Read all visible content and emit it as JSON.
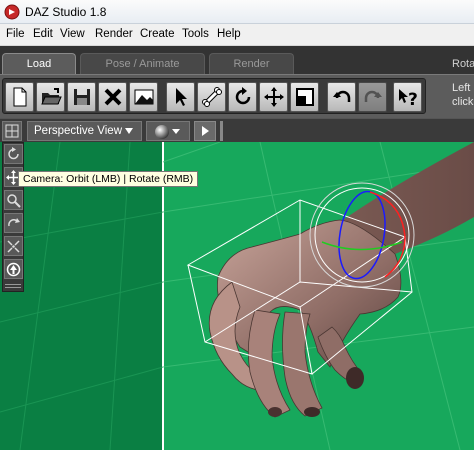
{
  "window": {
    "title": "DAZ Studio 1.8"
  },
  "menu": [
    {
      "label": "File"
    },
    {
      "label": "Edit"
    },
    {
      "label": "View"
    },
    {
      "label": "Render"
    },
    {
      "label": "Create"
    },
    {
      "label": "Tools"
    },
    {
      "label": "Help"
    }
  ],
  "tabs": [
    {
      "label": "Load",
      "active": true
    },
    {
      "label": "Pose / Animate",
      "active": false
    },
    {
      "label": "Render",
      "active": false
    }
  ],
  "tab_partial": "Rota",
  "toolbar": {
    "tools": [
      "new-document-icon",
      "open-folder-icon",
      "save-icon",
      "delete-icon",
      "render-image-icon",
      "select-arrow-icon",
      "bone-icon",
      "rotate-icon",
      "translate-icon",
      "scale-icon",
      "undo-icon",
      "redo-icon",
      "help-question-icon"
    ],
    "help_line1": "Left",
    "help_line2": "click"
  },
  "viewport": {
    "view_name": "Perspective View",
    "background_color": "#16a35a",
    "floor_color": "#0a7a3c",
    "nav_tools": [
      "orbit-icon",
      "pan-icon",
      "zoom-icon",
      "roll-icon",
      "frame-icon",
      "home-icon"
    ],
    "tooltip": "Camera: Orbit (LMB) | Rotate (RMB)"
  }
}
